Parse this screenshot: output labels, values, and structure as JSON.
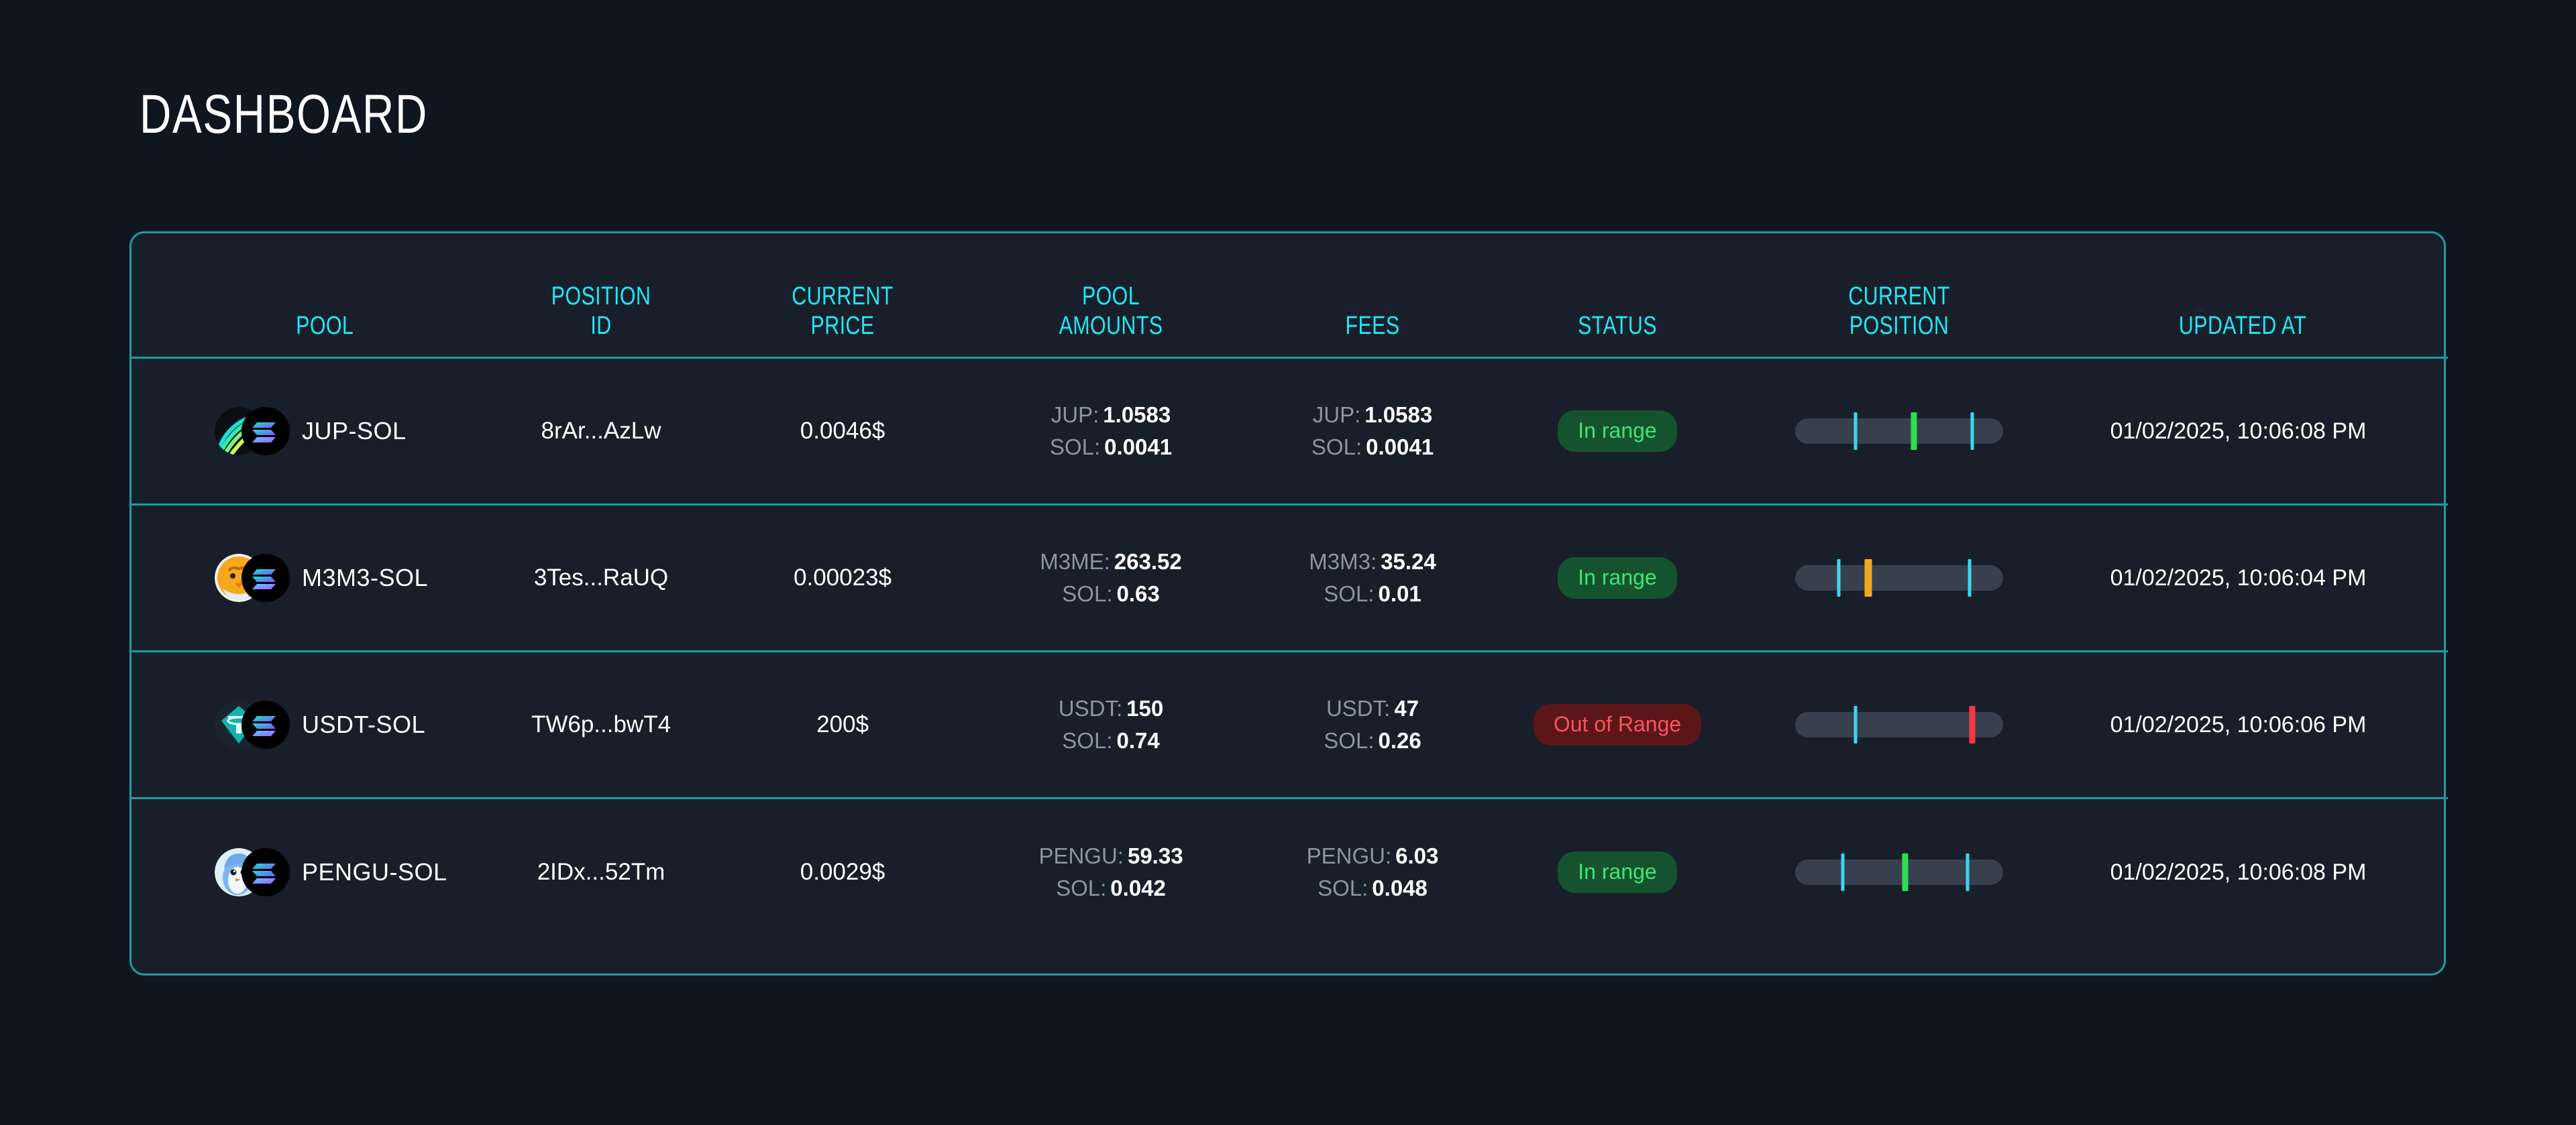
{
  "header": {
    "title": "DASHBOARD"
  },
  "theme": {
    "page_bg": "#101620",
    "card_bg": "#191f2a",
    "accent_teal": "#1f9d9d",
    "header_cyan": "#22e7f5",
    "in_range_bg": "#14532d",
    "in_range_text": "#3ee676",
    "out_range_bg": "#5c1618",
    "out_range_text": "#f9545c",
    "track": "#384050",
    "boundary_marker": "#3ad8f0",
    "current_ok": "#2fdd4f",
    "current_warn": "#efa920",
    "current_bad": "#f9373f"
  },
  "table": {
    "columns": [
      {
        "key": "pool",
        "label_line1": "POOL",
        "label_line2": ""
      },
      {
        "key": "position_id",
        "label_line1": "POSITION",
        "label_line2": "ID"
      },
      {
        "key": "current_price",
        "label_line1": "CURRENT",
        "label_line2": "PRICE"
      },
      {
        "key": "pool_amounts",
        "label_line1": "POOL",
        "label_line2": "AMOUNTS"
      },
      {
        "key": "fees",
        "label_line1": "FEES",
        "label_line2": ""
      },
      {
        "key": "status",
        "label_line1": "STATUS",
        "label_line2": ""
      },
      {
        "key": "current_position",
        "label_line1": "CURRENT",
        "label_line2": "POSITION"
      },
      {
        "key": "updated_at",
        "label_line1": "UPDATED AT",
        "label_line2": ""
      }
    ],
    "rows": [
      {
        "pool_name": "JUP-SOL",
        "icon_left": "jup-icon",
        "icon_right": "sol-icon",
        "position_id": "8rAr...AzLw",
        "current_price": "0.0046$",
        "pool_amounts": [
          {
            "label": "JUP:",
            "value": "1.0583"
          },
          {
            "label": "SOL:",
            "value": "0.0041"
          }
        ],
        "fees": [
          {
            "label": "JUP:",
            "value": "1.0583"
          },
          {
            "label": "SOL:",
            "value": "0.0041"
          }
        ],
        "status": "In range",
        "status_kind": "in-range",
        "position_bar": {
          "lower_pct": 29,
          "upper_pct": 85,
          "current_pct": 57,
          "current_kind": "cur-ok"
        },
        "updated_at": "01/02/2025, 10:06:08 PM"
      },
      {
        "pool_name": "M3M3-SOL",
        "icon_left": "m3m3-icon",
        "icon_right": "sol-icon",
        "position_id": "3Tes...RaUQ",
        "current_price": "0.00023$",
        "pool_amounts": [
          {
            "label": "M3ME:",
            "value": "263.52"
          },
          {
            "label": "SOL:",
            "value": "0.63"
          }
        ],
        "fees": [
          {
            "label": "M3M3:",
            "value": "35.24"
          },
          {
            "label": "SOL:",
            "value": "0.01"
          }
        ],
        "status": "In range",
        "status_kind": "in-range",
        "position_bar": {
          "lower_pct": 21,
          "upper_pct": 84,
          "current_pct": 35,
          "current_kind": "cur-warn"
        },
        "updated_at": "01/02/2025, 10:06:04 PM"
      },
      {
        "pool_name": "USDT-SOL",
        "icon_left": "usdt-icon",
        "icon_right": "sol-icon",
        "position_id": "TW6p...bwT4",
        "current_price": "200$",
        "pool_amounts": [
          {
            "label": "USDT:",
            "value": "150"
          },
          {
            "label": "SOL:",
            "value": "0.74"
          }
        ],
        "fees": [
          {
            "label": "USDT:",
            "value": "47"
          },
          {
            "label": "SOL:",
            "value": "0.26"
          }
        ],
        "status": "Out of Range",
        "status_kind": "out-range",
        "position_bar": {
          "lower_pct": 29,
          "upper_pct": 85,
          "current_pct": 85,
          "current_kind": "cur-bad"
        },
        "updated_at": "01/02/2025, 10:06:06 PM"
      },
      {
        "pool_name": "PENGU-SOL",
        "icon_left": "pengu-icon",
        "icon_right": "sol-icon",
        "position_id": "2IDx...52Tm",
        "current_price": "0.0029$",
        "pool_amounts": [
          {
            "label": "PENGU:",
            "value": "59.33"
          },
          {
            "label": "SOL:",
            "value": "0.042"
          }
        ],
        "fees": [
          {
            "label": "PENGU:",
            "value": "6.03"
          },
          {
            "label": "SOL:",
            "value": "0.048"
          }
        ],
        "status": "In range",
        "status_kind": "in-range",
        "position_bar": {
          "lower_pct": 23,
          "upper_pct": 83,
          "current_pct": 53,
          "current_kind": "cur-ok"
        },
        "updated_at": "01/02/2025, 10:06:08 PM"
      }
    ]
  }
}
